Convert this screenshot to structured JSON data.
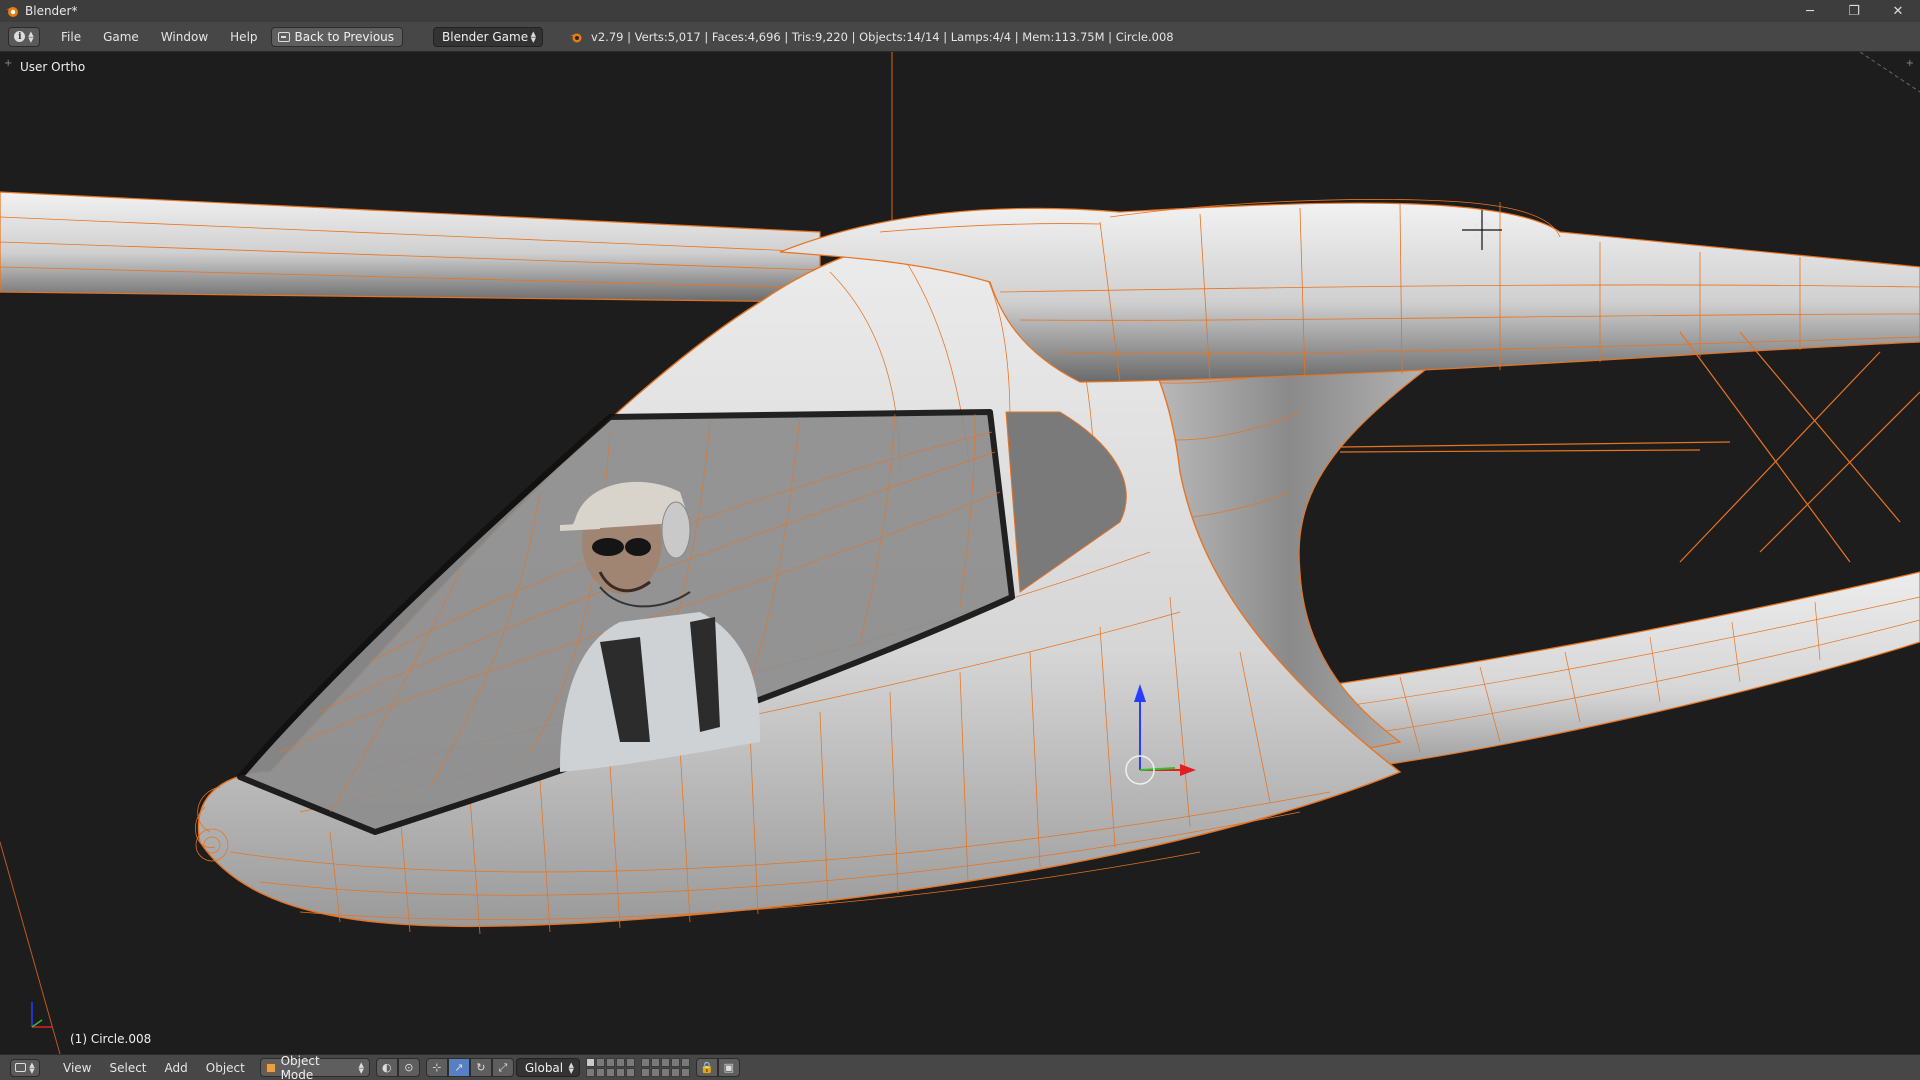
{
  "window": {
    "title": "Blender*",
    "minimize_glyph": "─",
    "restore_glyph": "❐",
    "close_glyph": "✕"
  },
  "info_header": {
    "menus": [
      "File",
      "Game",
      "Window",
      "Help"
    ],
    "back_button": "Back to Previous",
    "render_engine": "Blender Game",
    "stats": "v2.79 | Verts:5,017 | Faces:4,696 | Tris:9,220 | Objects:14/14 | Lamps:4/4 | Mem:113.75M | Circle.008"
  },
  "viewport": {
    "view_label": "User Ortho",
    "object_label": "(1) Circle.008",
    "colors": {
      "background": "#1d1d1d",
      "wire": "#e8731f",
      "body": "#d9d9d9",
      "canopy": "#8e8e8e"
    }
  },
  "view3d_header": {
    "menus": [
      "View",
      "Select",
      "Add",
      "Object"
    ],
    "mode": "Object Mode",
    "orientation": "Global",
    "icons": [
      "viewport-shading-icon",
      "pivot-icon",
      "manipulator-icon",
      "translate-icon",
      "rotate-icon",
      "scale-icon",
      "layers-icon",
      "lock-icon",
      "render-icon"
    ]
  }
}
